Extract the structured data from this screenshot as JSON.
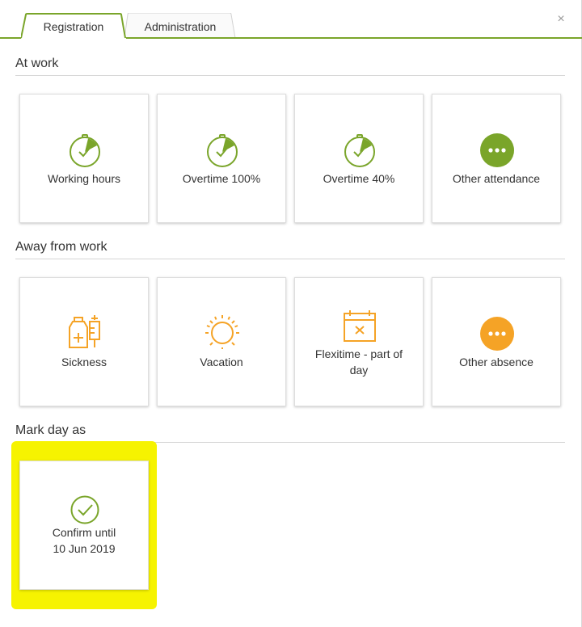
{
  "tabs": [
    {
      "label": "Registration",
      "active": true
    },
    {
      "label": "Administration",
      "active": false
    }
  ],
  "close_label": "×",
  "sections": {
    "at_work": {
      "title": "At work",
      "tiles": [
        {
          "label": "Working hours",
          "icon": "stopwatch-icon"
        },
        {
          "label": "Overtime 100%",
          "icon": "stopwatch-icon"
        },
        {
          "label": "Overtime 40%",
          "icon": "stopwatch-icon"
        },
        {
          "label": "Other attendance",
          "icon": "more-dots-icon"
        }
      ]
    },
    "away": {
      "title": "Away from work",
      "tiles": [
        {
          "label": "Sickness",
          "icon": "medicine-icon"
        },
        {
          "label": "Vacation",
          "icon": "sun-icon"
        },
        {
          "label_line1": "Flexitime - part of",
          "label_line2": "day",
          "icon": "calendar-icon"
        },
        {
          "label": "Other absence",
          "icon": "more-dots-icon"
        }
      ]
    },
    "mark_day": {
      "title": "Mark day as",
      "tiles": [
        {
          "label_line1": "Confirm until",
          "label_line2": "10 Jun 2019",
          "icon": "check-circle-icon"
        }
      ]
    }
  },
  "colors": {
    "green": "#7aa52a",
    "orange": "#f5a326",
    "highlight": "#f6f300"
  }
}
